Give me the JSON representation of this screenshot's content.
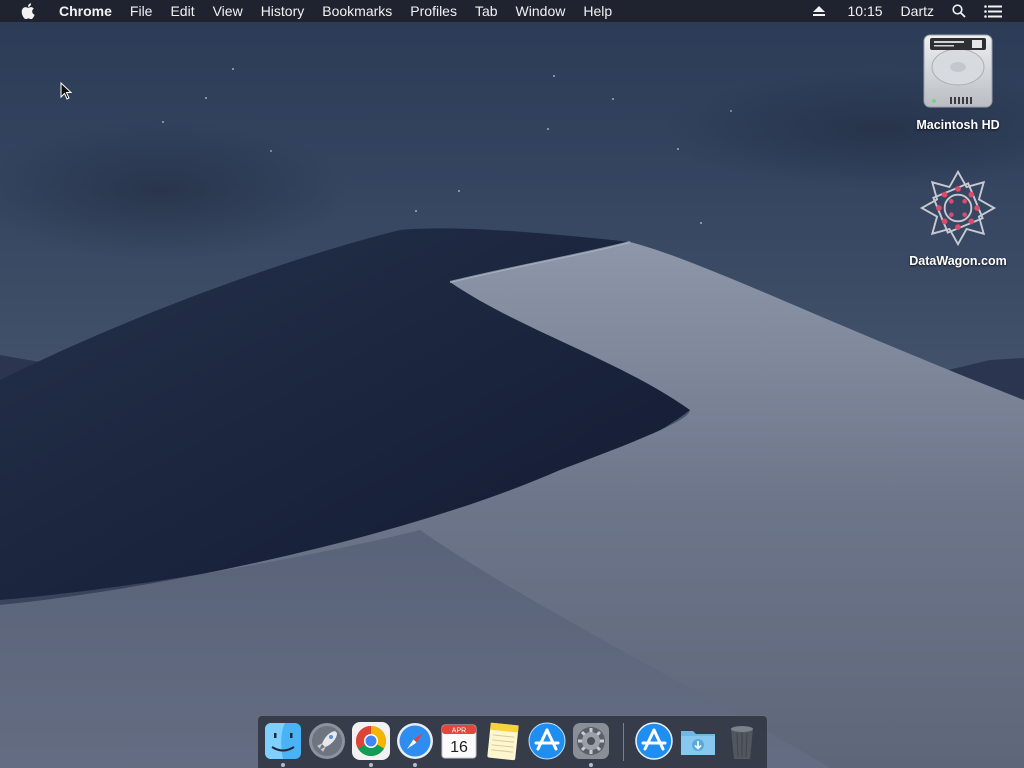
{
  "menubar": {
    "app_name": "Chrome",
    "menus": [
      "File",
      "Edit",
      "View",
      "History",
      "Bookmarks",
      "Profiles",
      "Tab",
      "Window",
      "Help"
    ],
    "clock": "10:15",
    "user": "Dartz"
  },
  "desktop_icons": [
    {
      "label": "Macintosh HD",
      "icon": "hard-drive-icon"
    },
    {
      "label": "DataWagon.com",
      "icon": "datawagon-logo-icon"
    }
  ],
  "calendar": {
    "month": "APR",
    "day": "16"
  },
  "dock": {
    "apps": [
      {
        "name": "finder",
        "icon": "finder-icon",
        "running": true
      },
      {
        "name": "launchpad",
        "icon": "launchpad-icon",
        "running": false
      },
      {
        "name": "chrome",
        "icon": "chrome-icon",
        "running": true
      },
      {
        "name": "safari",
        "icon": "safari-icon",
        "running": true
      },
      {
        "name": "calendar",
        "icon": "calendar-icon",
        "running": false
      },
      {
        "name": "notes",
        "icon": "notes-icon",
        "running": false
      },
      {
        "name": "app-store",
        "icon": "app-store-icon",
        "running": false
      },
      {
        "name": "system-preferences",
        "icon": "system-preferences-icon",
        "running": true
      },
      {
        "name": "applications-folder",
        "icon": "applications-stack-icon",
        "running": false
      },
      {
        "name": "downloads-folder",
        "icon": "downloads-folder-icon",
        "running": false
      },
      {
        "name": "trash",
        "icon": "trash-icon",
        "running": false
      }
    ]
  },
  "colors": {
    "menubar_bg": "#1e222d",
    "sky_top": "#2b3a55",
    "dune_light": "#8a93a6",
    "dune_dark": "#141d33"
  }
}
